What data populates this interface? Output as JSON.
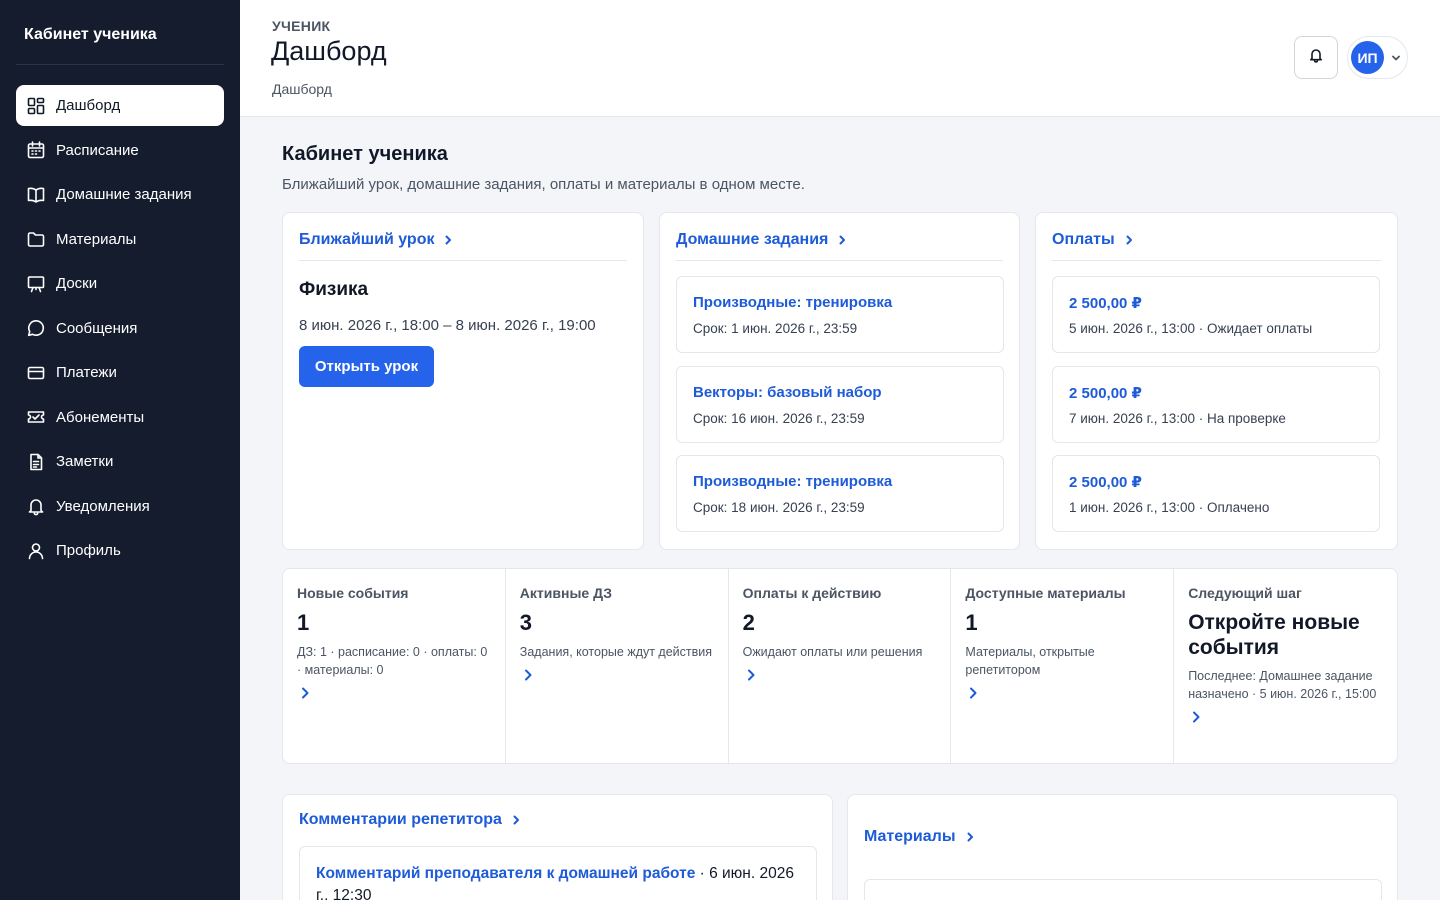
{
  "sidebar": {
    "title": "Кабинет ученика",
    "items": [
      {
        "label": "Дашборд",
        "icon": "dashboard-icon",
        "active": true
      },
      {
        "label": "Расписание",
        "icon": "calendar-icon"
      },
      {
        "label": "Домашние задания",
        "icon": "book-icon"
      },
      {
        "label": "Материалы",
        "icon": "folder-icon"
      },
      {
        "label": "Доски",
        "icon": "board-icon"
      },
      {
        "label": "Сообщения",
        "icon": "chat-icon"
      },
      {
        "label": "Платежи",
        "icon": "card-icon"
      },
      {
        "label": "Абонементы",
        "icon": "ticket-icon"
      },
      {
        "label": "Заметки",
        "icon": "note-icon"
      },
      {
        "label": "Уведомления",
        "icon": "bell-icon"
      },
      {
        "label": "Профиль",
        "icon": "user-icon"
      }
    ]
  },
  "header": {
    "role": "УЧЕНИК",
    "title": "Дашборд",
    "breadcrumb": "Дашборд",
    "avatar_initials": "ИП"
  },
  "main": {
    "title": "Кабинет ученика",
    "subtitle": "Ближайший урок, домашние задания, оплаты и материалы в одном месте.",
    "next_lesson": {
      "heading": "Ближайший урок",
      "subject": "Физика",
      "time": "8 июн. 2026 г., 18:00 – 8 июн. 2026 г., 19:00",
      "button": "Открыть урок"
    },
    "homework": {
      "heading": "Домашние задания",
      "items": [
        {
          "title": "Производные: тренировка",
          "due": "Срок: 1 июн. 2026 г., 23:59"
        },
        {
          "title": "Векторы: базовый набор",
          "due": "Срок: 16 июн. 2026 г., 23:59"
        },
        {
          "title": "Производные: тренировка",
          "due": "Срок: 18 июн. 2026 г., 23:59"
        }
      ]
    },
    "payments": {
      "heading": "Оплаты",
      "items": [
        {
          "amount": "2 500,00 ₽",
          "info": "5 июн. 2026 г., 13:00 · Ожидает оплаты"
        },
        {
          "amount": "2 500,00 ₽",
          "info": "7 июн. 2026 г., 13:00 · На проверке"
        },
        {
          "amount": "2 500,00 ₽",
          "info": "1 июн. 2026 г., 13:00 · Оплачено"
        }
      ]
    },
    "stats": [
      {
        "label": "Новые события",
        "value": "1",
        "desc": "ДЗ: 1 · расписание: 0 · оплаты: 0 · материалы: 0"
      },
      {
        "label": "Активные ДЗ",
        "value": "3",
        "desc": "Задания, которые ждут действия"
      },
      {
        "label": "Оплаты к действию",
        "value": "2",
        "desc": "Ожидают оплаты или решения"
      },
      {
        "label": "Доступные материалы",
        "value": "1",
        "desc": "Материалы, открытые репетитором"
      },
      {
        "label": "Следующий шаг",
        "big": "Откройте новые события",
        "desc": "Последнее: Домашнее задание назначено · 5 июн. 2026 г., 15:00"
      }
    ],
    "comments": {
      "heading": "Комментарии репетитора",
      "item_link": "Комментарий преподавателя к домашней работе",
      "item_date": " · 6 июн. 2026 г., 12:30"
    },
    "materials": {
      "heading": "Материалы"
    }
  },
  "colors": {
    "sidebar_bg": "#151c2e",
    "accent": "#2563eb",
    "link": "#1d5bd8"
  }
}
